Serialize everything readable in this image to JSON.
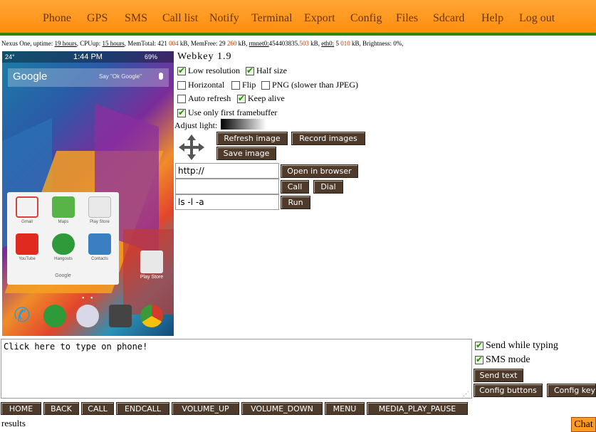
{
  "nav": [
    "Phone",
    "GPS",
    "SMS",
    "Call list",
    "Notify",
    "Terminal",
    "Export",
    "Config",
    "Files",
    "Sdcard",
    "Help",
    "Log out"
  ],
  "status": {
    "device": "Nexus One",
    "uptime_label": "uptime:",
    "uptime": "19 hours",
    "cpu_label": "CPUup:",
    "cpu": "15 hours",
    "memtotal_label": "MemTotal: 421",
    "memtotal_tail": "004",
    "memtotal_unit": "kB",
    "memfree_label": "MemFree: 29",
    "memfree_tail": "260",
    "memfree_unit": "kB",
    "rmnet_label": "rmnet0:",
    "rmnet": "454403835",
    "rmnet_tail": "503",
    "rmnet_unit": "kB",
    "eth_label": "eth0:",
    "eth": "5",
    "eth_tail": "010",
    "eth_unit": "kB",
    "brightness": "Brightness: 0%"
  },
  "phone": {
    "temp": "24°",
    "time": "1:44 PM",
    "battery": "69%",
    "search_logo": "Google",
    "search_hint": "Say \"Ok Google\"",
    "folder_name": "Google",
    "apps": [
      "Gmail",
      "Maps",
      "Play Store",
      "YouTube",
      "Hangouts",
      "Contacts"
    ],
    "desktop_app": "Play Store",
    "colors": {
      "gmail": "#d8403a",
      "maps": "#58b447",
      "play": "#e9e9e9",
      "youtube": "#e02a20",
      "hangouts": "#2e9a3a",
      "contacts": "#3a7fc2"
    }
  },
  "panel": {
    "title": "Webkey 1.9",
    "low_resolution": "Low resolution",
    "half_size": "Half size",
    "horizontal": "Horizontal",
    "flip": "Flip",
    "png": "PNG (slower than JPEG)",
    "auto_refresh": "Auto refresh",
    "keep_alive": "Keep alive",
    "first_fb": "Use only first framebuffer",
    "adjust_light": "Adjust light:",
    "refresh_image": "Refresh image",
    "record_images": "Record images",
    "save_image": "Save image",
    "url_value": "http://",
    "open_browser": "Open in browser",
    "phone_value": "",
    "call": "Call",
    "dial": "Dial",
    "cmd_value": "ls -l -a",
    "run": "Run"
  },
  "input": {
    "text": "Click here to type on phone!",
    "send_while_typing": "Send while typing",
    "sms_mode": "SMS mode",
    "send_text": "Send text",
    "config_buttons": "Config buttons",
    "config_keys": "Config keys"
  },
  "keys": [
    "HOME",
    "BACK",
    "CALL",
    "ENDCALL",
    "VOLUME_UP",
    "VOLUME_DOWN",
    "MENU",
    "MEDIA_PLAY_PAUSE"
  ],
  "results": "results",
  "chat": "Chat"
}
